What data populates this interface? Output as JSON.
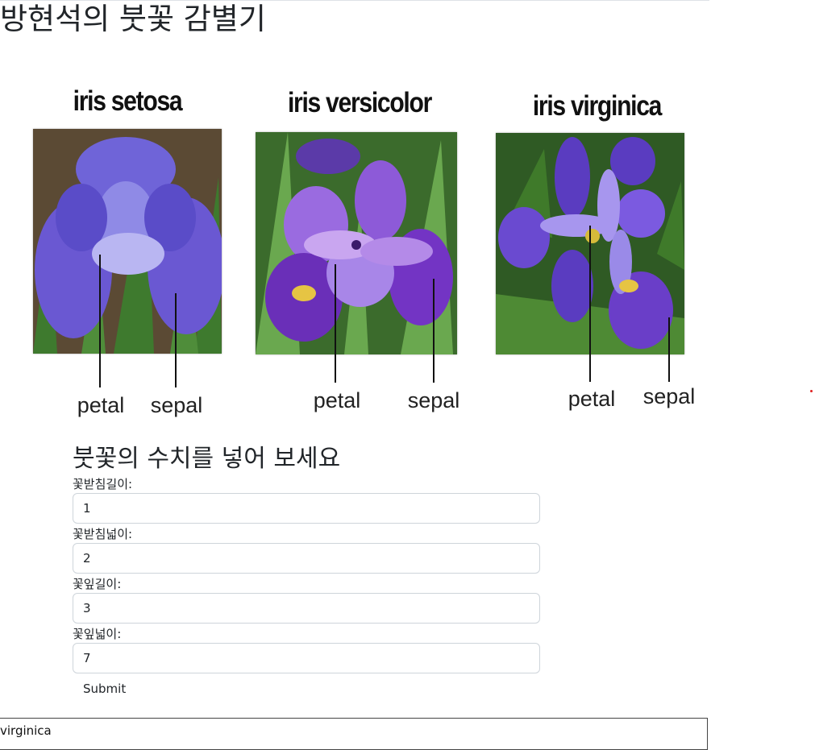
{
  "page": {
    "title": "방현석의 붓꽃 감별기"
  },
  "figure": {
    "species": [
      {
        "name": "iris setosa",
        "petal_label": "petal",
        "sepal_label": "sepal"
      },
      {
        "name": "iris versicolor",
        "petal_label": "petal",
        "sepal_label": "sepal"
      },
      {
        "name": "iris virginica",
        "petal_label": "petal",
        "sepal_label": "sepal"
      }
    ]
  },
  "form": {
    "heading": "붓꽃의 수치를 넣어 보세요",
    "fields": [
      {
        "label": "꽃받침길이:",
        "value": "1"
      },
      {
        "label": "꽃받침넓이:",
        "value": "2"
      },
      {
        "label": "꽃잎길이:",
        "value": "3"
      },
      {
        "label": "꽃잎넓이:",
        "value": "7"
      }
    ],
    "submit_label": "Submit"
  },
  "result": {
    "text": "virginica"
  },
  "colors": {
    "petal_violet": "#6a5acd",
    "petal_purple": "#7b3fc8",
    "leaf_green": "#3f7a2a",
    "indicator_red": "#e02020"
  }
}
